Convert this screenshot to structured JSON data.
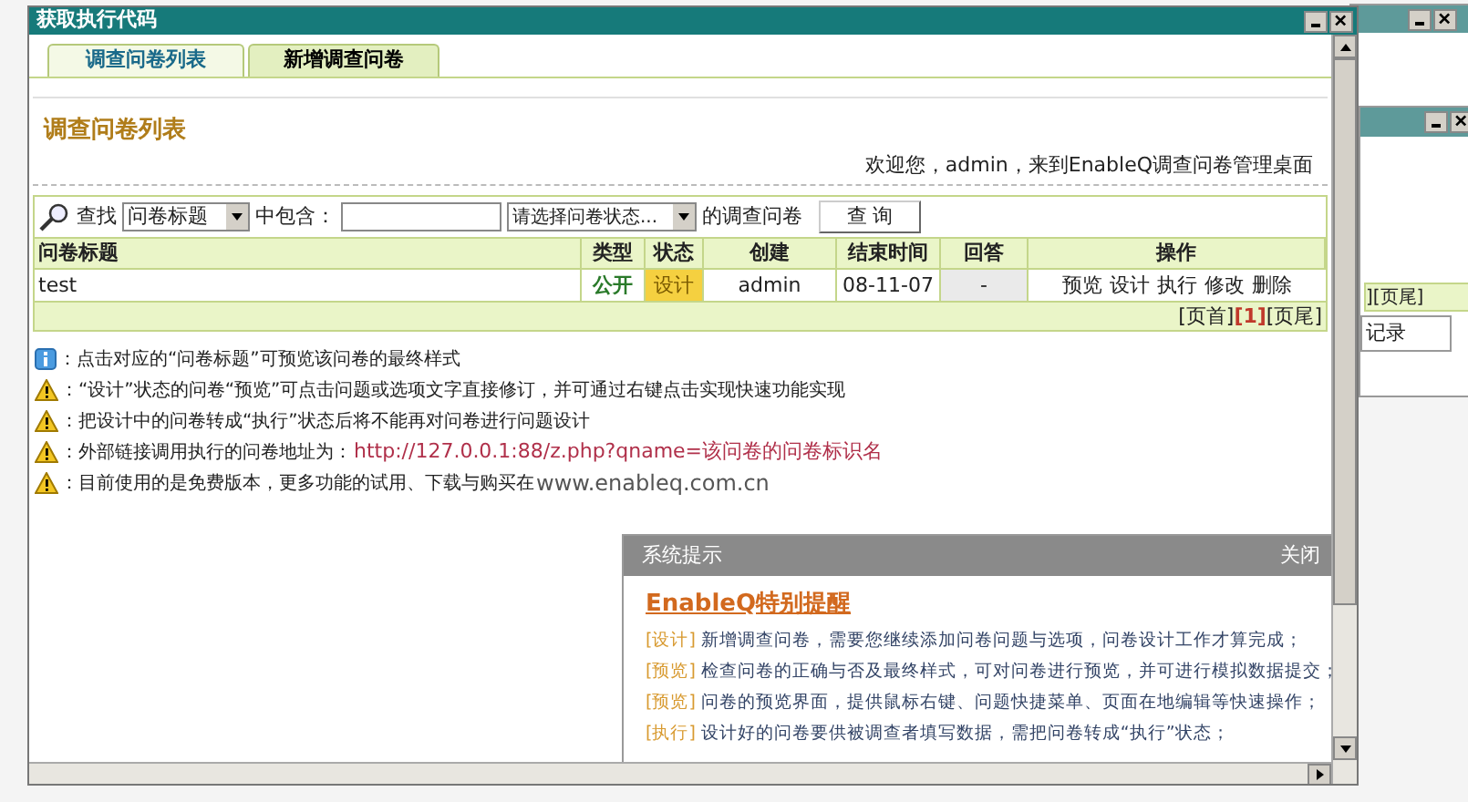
{
  "window": {
    "title": "获取执行代码"
  },
  "tabs": [
    {
      "label": "调查问卷列表",
      "selected": true
    },
    {
      "label": "新增调查问卷",
      "selected": false
    }
  ],
  "page_title": "调查问卷列表",
  "welcome": "欢迎您，admin，来到EnableQ调查问卷管理桌面",
  "search": {
    "label": "查找",
    "field_select": "问卷标题",
    "contains_label": "中包含：",
    "status_select": "请选择问卷状态...",
    "suffix": "的调查问卷",
    "button": "查 询"
  },
  "table": {
    "columns": [
      "问卷标题",
      "类型",
      "状态",
      "创建",
      "结束时间",
      "回答",
      "操作"
    ],
    "rows": [
      {
        "title": "test",
        "type": "公开",
        "status": "设计",
        "creator": "admin",
        "end_time": "08-11-07",
        "answers": "-",
        "actions": [
          "预览",
          "设计",
          "执行",
          "修改",
          "删除"
        ]
      }
    ]
  },
  "pagination": [
    {
      "label": "[页首]",
      "selected": false
    },
    {
      "label": "[1]",
      "selected": true
    },
    {
      "label": "[页尾]",
      "selected": false
    }
  ],
  "notes": [
    {
      "kind": "info",
      "text": "：点击对应的“问卷标题”可预览该问卷的最终样式"
    },
    {
      "kind": "warning",
      "text": "：“设计”状态的问卷“预览”可点击问题或选项文字直接修订，并可通过右键点击实现快速功能实现"
    },
    {
      "kind": "warning",
      "text": "：把设计中的问卷转成“执行”状态后将不能再对问卷进行问题设计"
    },
    {
      "kind": "warning",
      "text": "：外部链接调用执行的问卷地址为：",
      "link": "http://127.0.0.1:88/z.php?qname=该问卷的问卷标识名"
    },
    {
      "kind": "warning",
      "text": "：目前使用的是免费版本，更多功能的试用、下载与购买在",
      "url": "www.enableq.com.cn"
    }
  ],
  "popup": {
    "title": "系统提示",
    "close": "关闭",
    "heading": "EnableQ特别提醒",
    "items": [
      {
        "tag": "[设计]",
        "text": "新增调查问卷，需要您继续添加问卷问题与选项，问卷设计工作才算完成；"
      },
      {
        "tag": "[预览]",
        "text": "检查问卷的正确与否及最终样式，可对问卷进行预览，并可进行模拟数据提交；"
      },
      {
        "tag": "[预览]",
        "text": "问卷的预览界面，提供鼠标右键、问题快捷菜单、页面在地编辑等快速操作；"
      },
      {
        "tag": "[执行]",
        "text": "设计好的问卷要供被调查者填写数据，需把问卷转成“执行”状态；"
      }
    ]
  },
  "back_window": {
    "pagination": "][页尾]",
    "button": "记录"
  }
}
